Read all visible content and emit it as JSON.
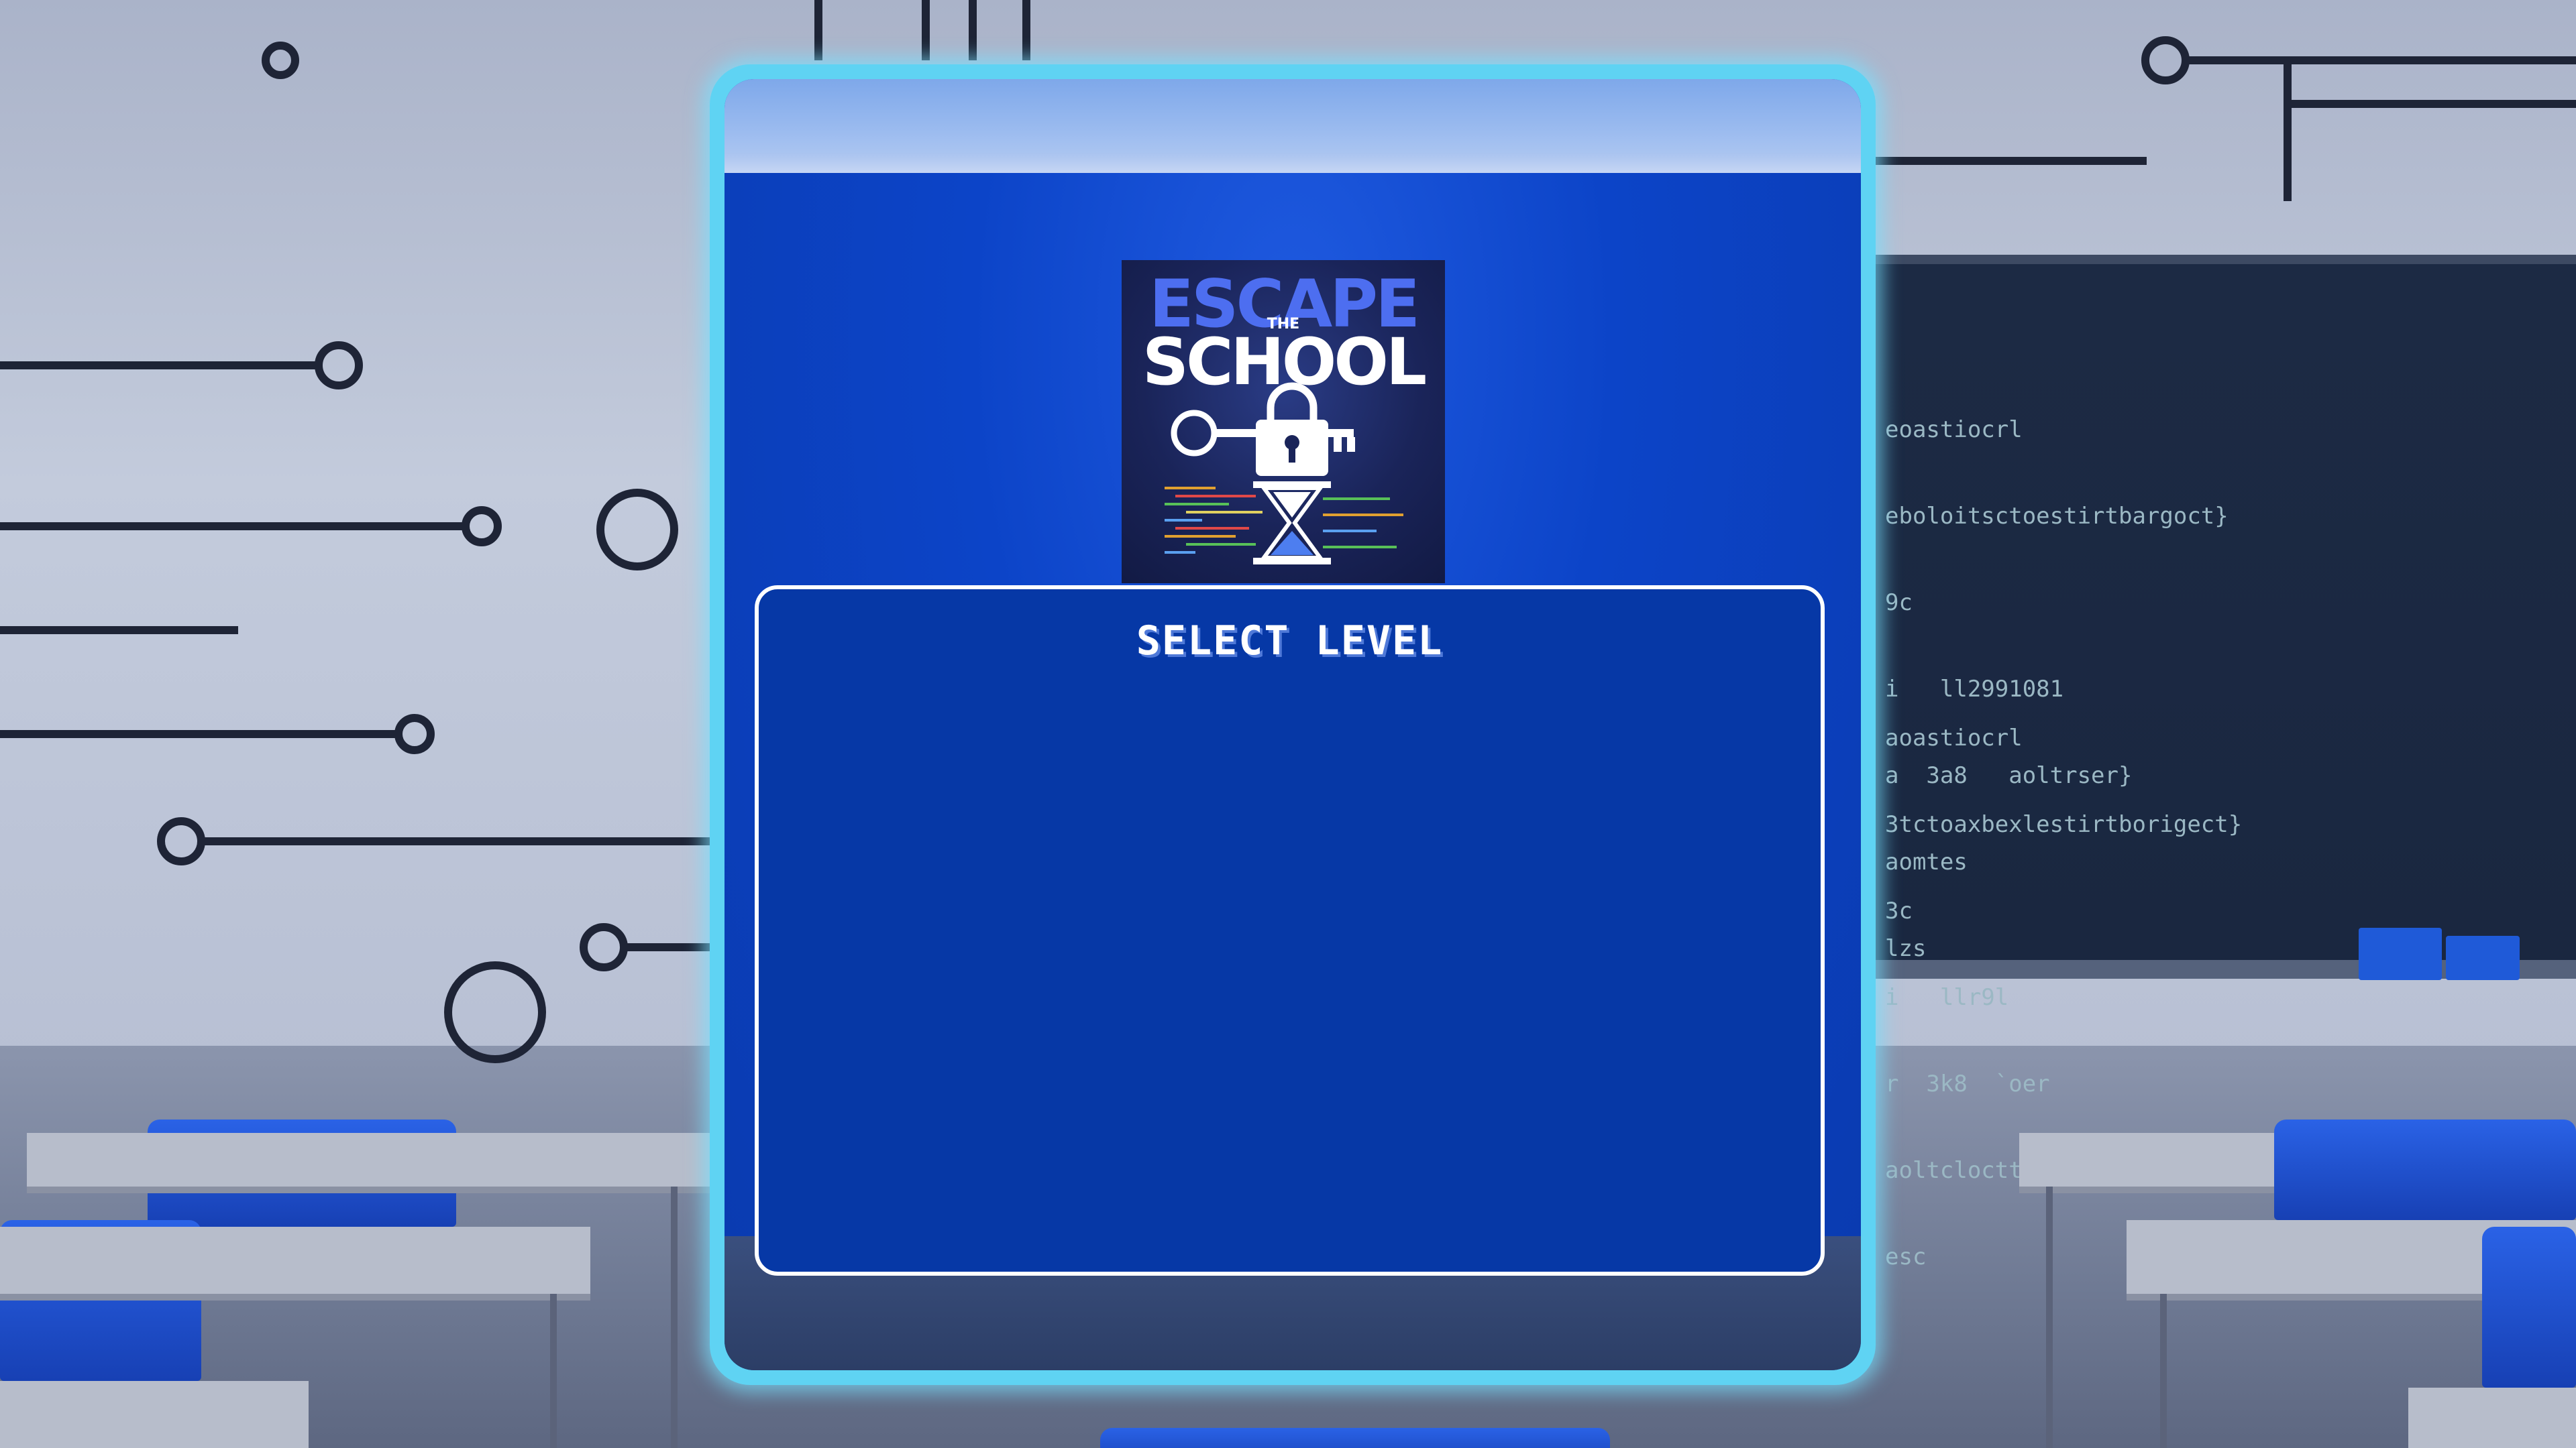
{
  "game": {
    "logo": {
      "title_top": "ESCAPE",
      "title_small": "THE",
      "title_bottom": "SCHOOL"
    },
    "level_select": {
      "title": "SELECT LEVEL"
    }
  },
  "background": {
    "chalkboard_lines_1": [
      "eoastiocrl",
      "eboloitsctoestirtbargoct}",
      "9c",
      "i   ll2991081",
      "a  3a8   aoltrser}",
      "aomtes",
      "lzs"
    ],
    "chalkboard_lines_2": [
      "aoastiocrl",
      "3tctoaxbexlestirtborigect}",
      "3c",
      "i   llr9l",
      "r  3k8  `oer",
      "aoltclocttbestirtborset}",
      "esc"
    ]
  },
  "colors": {
    "frame_glow": "#5fd3f3",
    "panel": "#0638a6",
    "logo_blue": "#4d6ef0"
  }
}
